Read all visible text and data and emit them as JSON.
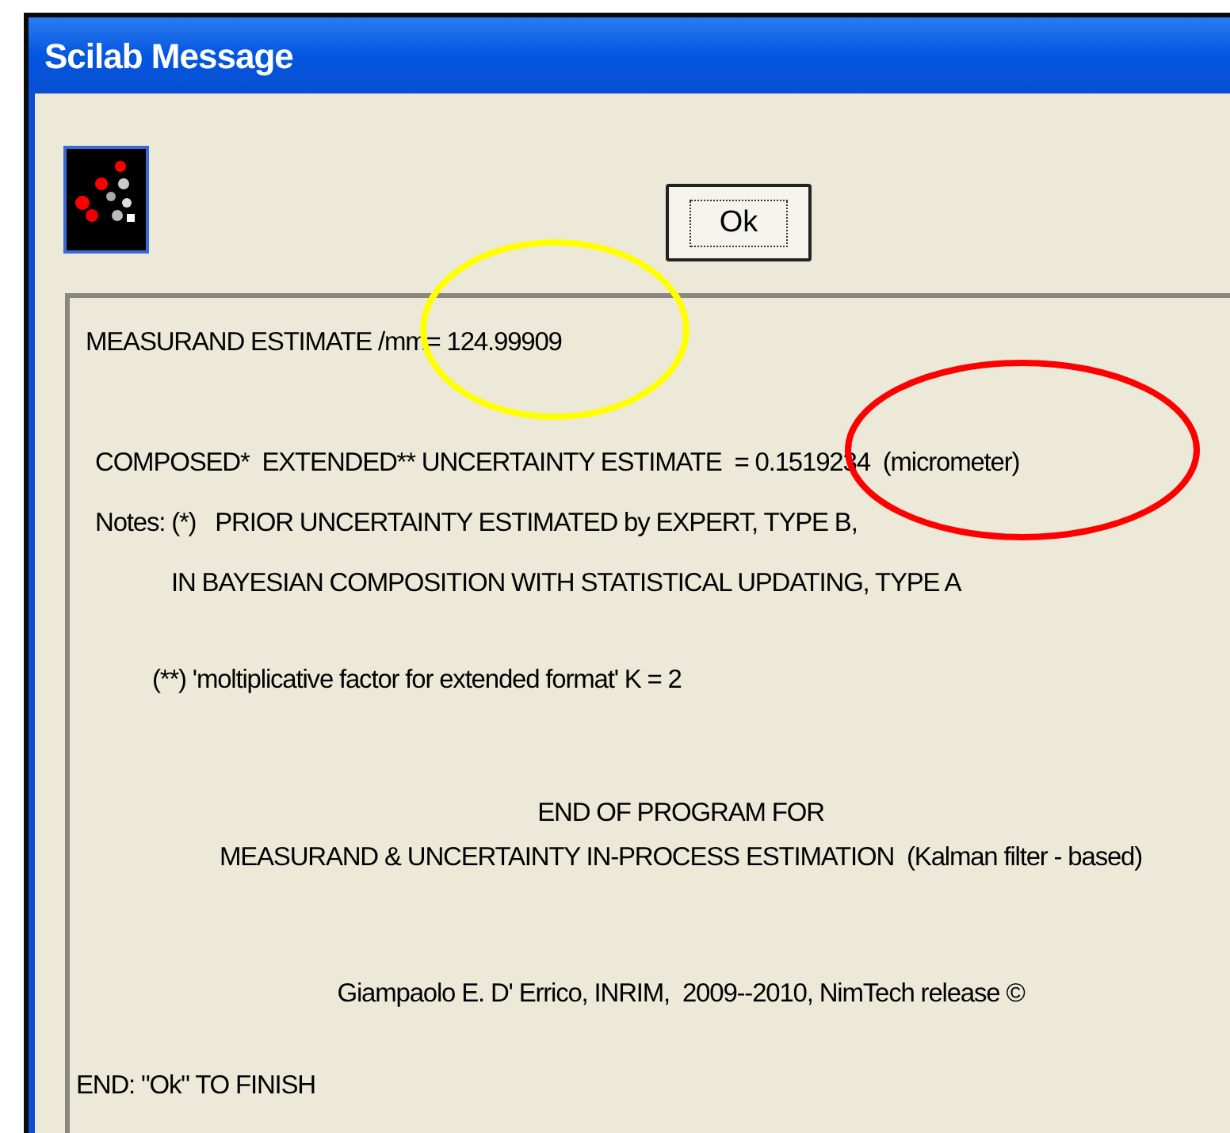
{
  "window": {
    "title": "Scilab Message"
  },
  "ok_button": {
    "label": "Ok"
  },
  "message_lines": [
    {
      "kind": "first",
      "text": "MEASURAND ESTIMATE /mm= 124.99909"
    },
    {
      "kind": "body",
      "text": "COMPOSED*  EXTENDED** UNCERTAINTY ESTIMATE  = 0.1519234  (micrometer)"
    },
    {
      "kind": "body",
      "text": "Notes: (*)   PRIOR UNCERTAINTY ESTIMATED by EXPERT, TYPE B,"
    },
    {
      "kind": "indented",
      "text": "IN BAYESIAN COMPOSITION WITH STATISTICAL UPDATING, TYPE A"
    },
    {
      "kind": "footnote",
      "text": "(**) 'moltiplicative factor for extended format' K = 2"
    },
    {
      "kind": "centered",
      "text": "END OF PROGRAM FOR"
    },
    {
      "kind": "centered",
      "text": "MEASURAND & UNCERTAINTY IN-PROCESS ESTIMATION  (Kalman filter - based)"
    },
    {
      "kind": "credit",
      "text": "Giampaolo E. D' Errico, INRIM,  2009--2010, NimTech release ©"
    },
    {
      "kind": "last",
      "text": "END: \"Ok\" TO FINISH"
    }
  ],
  "annotations": [
    {
      "kind": "ellipse",
      "color": "#ffff00"
    },
    {
      "kind": "ellipse",
      "color": "#ff0000"
    }
  ]
}
